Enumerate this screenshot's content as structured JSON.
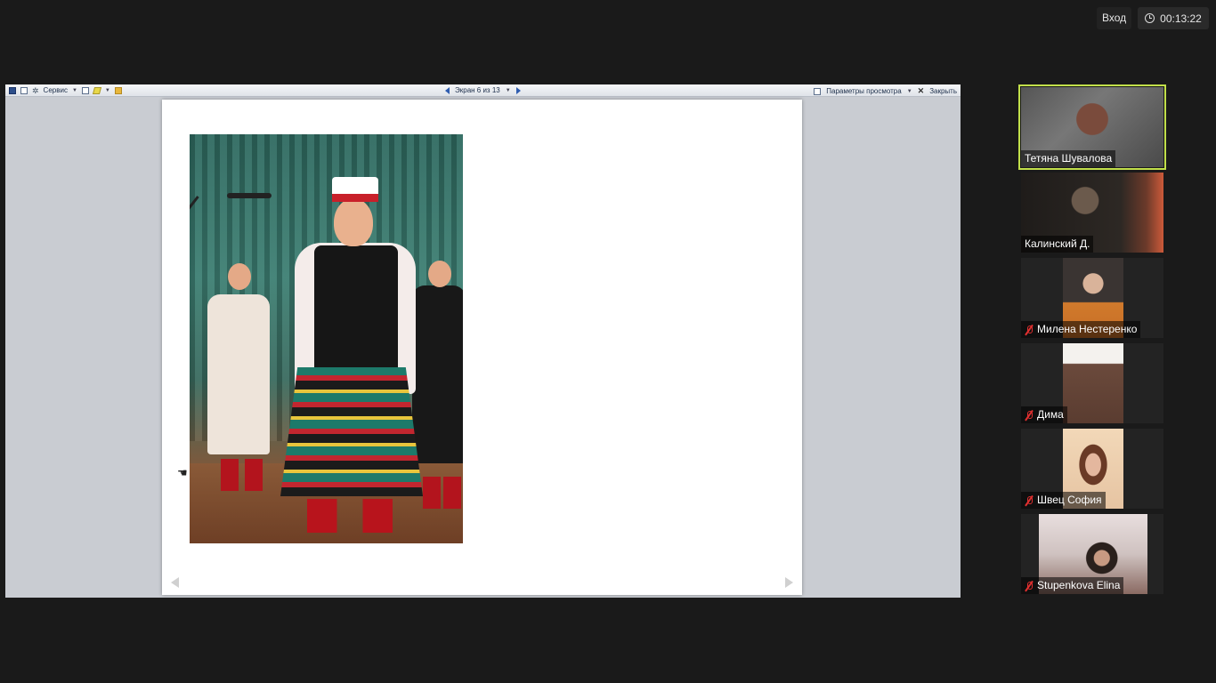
{
  "topbar": {
    "enter_label": "Вход",
    "timer": "00:13:22"
  },
  "presentation_toolbar": {
    "tools_label": "Сервис",
    "screen_counter": "Экран 6 из 13",
    "view_options_label": "Параметры просмотра",
    "close_label": "Закрыть"
  },
  "participants": [
    {
      "name": "Тетяна Шувалова",
      "muted": false,
      "active": true
    },
    {
      "name": "Калинский Д.",
      "muted": false,
      "active": false
    },
    {
      "name": "Милена Нестеренко",
      "muted": true,
      "active": false
    },
    {
      "name": "Дима",
      "muted": true,
      "active": false
    },
    {
      "name": "Швец София",
      "muted": true,
      "active": false
    },
    {
      "name": "Stupenkova Elina",
      "muted": true,
      "active": false
    }
  ],
  "colors": {
    "active_speaker_border": "#c2e04a",
    "muted_icon": "#e02f2f",
    "background": "#1a1a1a"
  }
}
